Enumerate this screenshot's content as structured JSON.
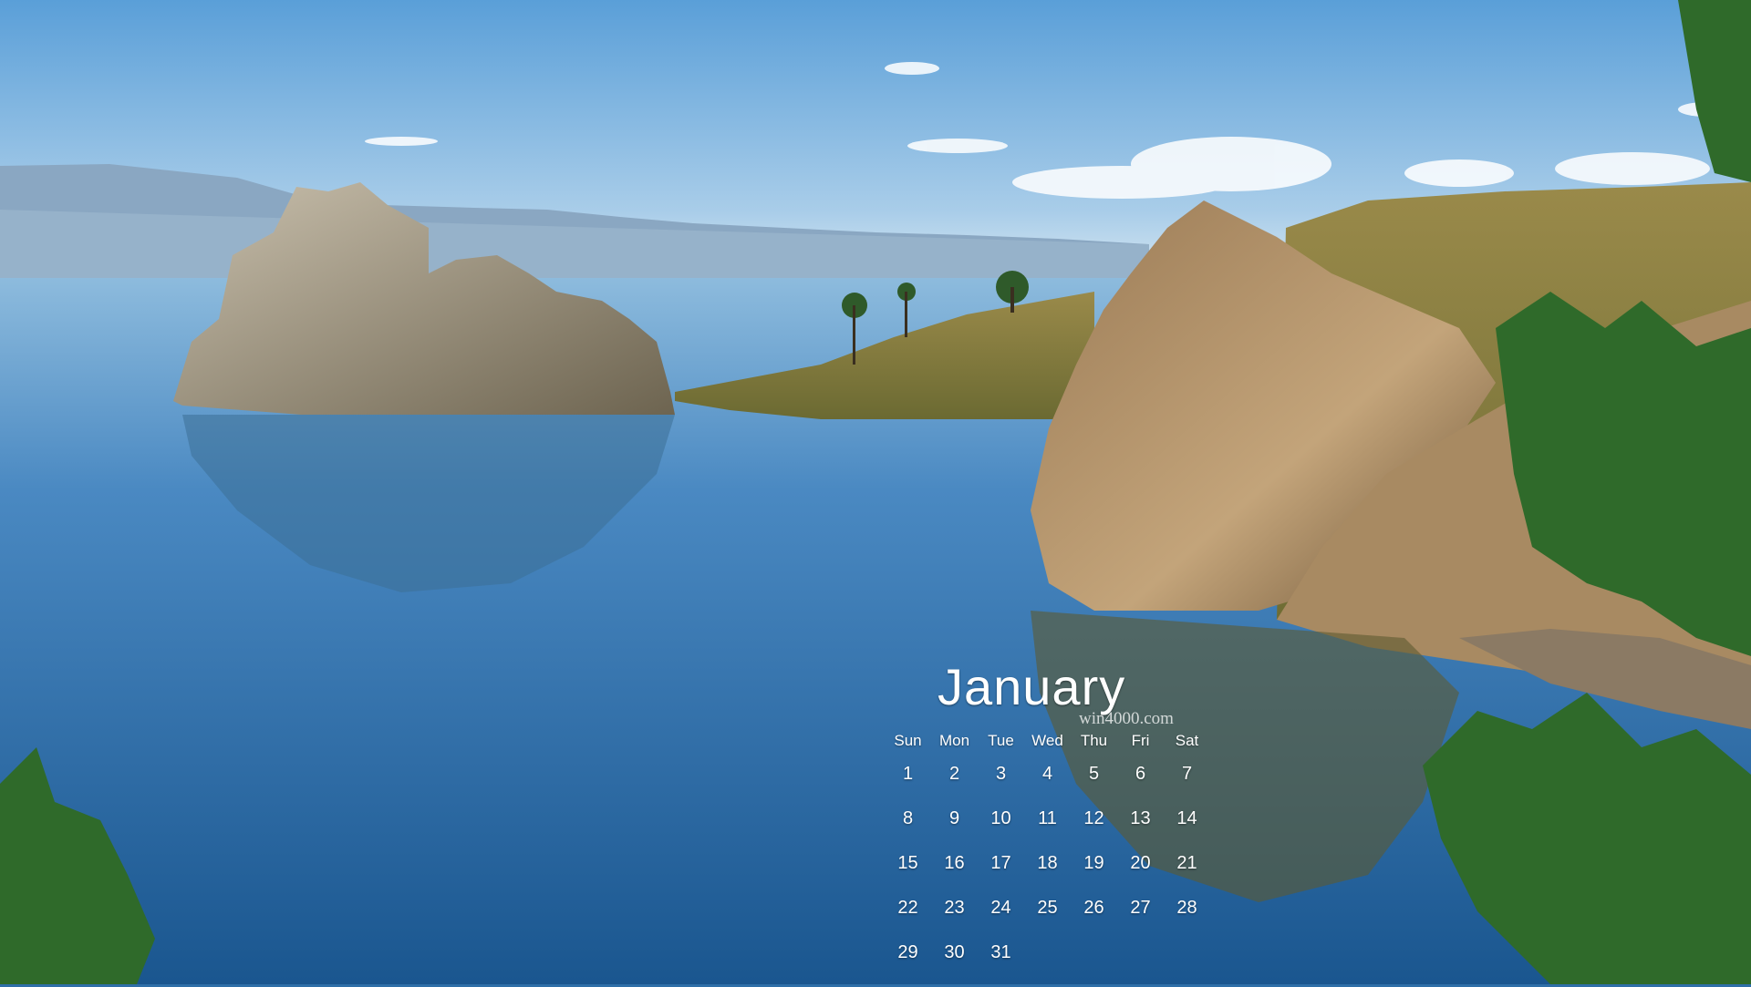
{
  "calendar": {
    "month": "January",
    "watermark": "win4000.com",
    "weekdays": [
      "Sun",
      "Mon",
      "Tue",
      "Wed",
      "Thu",
      "Fri",
      "Sat"
    ],
    "weeks": [
      [
        "1",
        "2",
        "3",
        "4",
        "5",
        "6",
        "7"
      ],
      [
        "8",
        "9",
        "10",
        "11",
        "12",
        "13",
        "14"
      ],
      [
        "15",
        "16",
        "17",
        "18",
        "19",
        "20",
        "21"
      ],
      [
        "22",
        "23",
        "24",
        "25",
        "26",
        "27",
        "28"
      ],
      [
        "29",
        "30",
        "31",
        "",
        "",
        "",
        ""
      ]
    ]
  },
  "scene": {
    "subject": "lake-with-rock-islands-and-cliffs",
    "colors": {
      "sky_top": "#5a9fd8",
      "sky_horizon": "#cfe3f1",
      "water_top": "#7fb3d8",
      "water_deep": "#1c5a94",
      "rock": "#a89070",
      "grass": "#7f7a3a",
      "tree": "#2f6a2a"
    }
  }
}
